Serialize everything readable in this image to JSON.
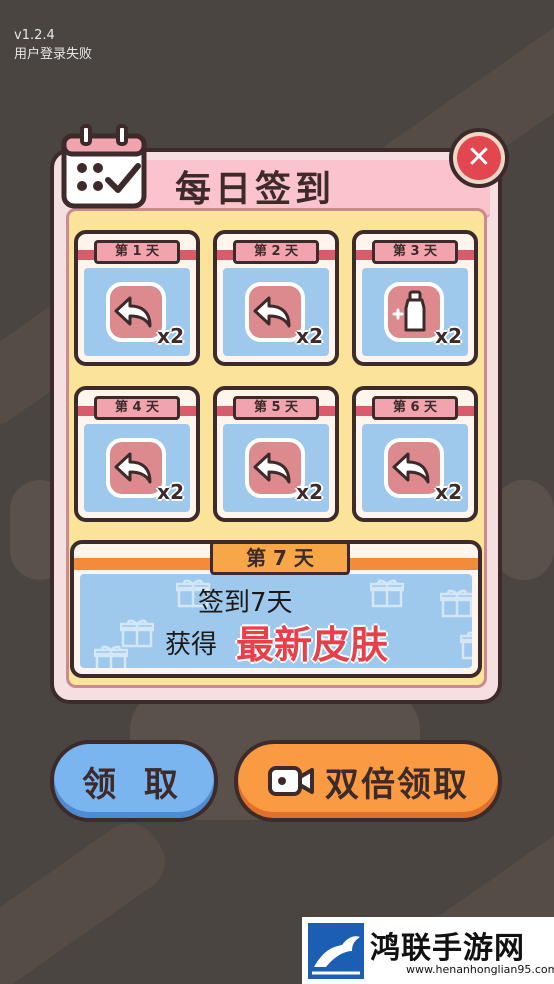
{
  "status": {
    "version": "v1.2.4",
    "message": "用户登录失败"
  },
  "dialog": {
    "title": "每日签到",
    "close_label": "✕",
    "days": [
      {
        "label": "第 1 天",
        "reward_icon": "undo-arrow-icon",
        "qty": "x2"
      },
      {
        "label": "第 2 天",
        "reward_icon": "undo-arrow-icon",
        "qty": "x2"
      },
      {
        "label": "第 3 天",
        "reward_icon": "bottle-plus-icon",
        "qty": "x2"
      },
      {
        "label": "第 4 天",
        "reward_icon": "undo-arrow-icon",
        "qty": "x2"
      },
      {
        "label": "第 5 天",
        "reward_icon": "undo-arrow-icon",
        "qty": "x2"
      },
      {
        "label": "第 6 天",
        "reward_icon": "undo-arrow-icon",
        "qty": "x2"
      }
    ],
    "day7": {
      "label": "第 7 天",
      "line1": "签到7天",
      "line2_prefix": "获得",
      "line2_highlight": "最新皮肤"
    }
  },
  "buttons": {
    "claim": "领 取",
    "double_claim": "双倍领取"
  },
  "watermark": {
    "title": "鸿联手游网",
    "url": "www.henanhonglian95.com"
  },
  "colors": {
    "highlight": "#e8404a",
    "claim_button": "#7ab5ef",
    "double_button": "#fa9a43",
    "close_button": "#e2464f"
  }
}
